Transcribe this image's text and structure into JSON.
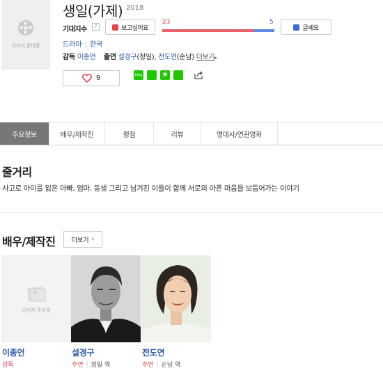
{
  "poster": {
    "placeholder": "이미지 준비중"
  },
  "movie": {
    "title": "생일(가제)",
    "year": "2018"
  },
  "expectation": {
    "label": "기대지수",
    "help": "?",
    "want_label": "보고싶어요",
    "not_want_label": "글쎄요",
    "want_count": "23",
    "not_want_count": "5",
    "want_fraction": 0.82
  },
  "genres": [
    "드라마",
    "한국"
  ],
  "credits": {
    "director_label": "감독",
    "director": "이종언",
    "cast_label": "출연",
    "cast1": "설경구",
    "cast1_role": "(정일),",
    "cast2": "전도연",
    "cast2_role": "(순남)",
    "more": "더보기"
  },
  "likes": {
    "count": "9"
  },
  "share": {
    "blog": "blog"
  },
  "tabs": [
    "주요정보",
    "배우/제작진",
    "평점",
    "리뷰",
    "명대사/연관영화"
  ],
  "synopsis": {
    "title": "줄거리",
    "text": "사고로 아이를 잃은 아빠, 엄마, 동생 그리고 남겨진 이들이 함께 서로의 아픈 마음을 보듬어가는 이야기"
  },
  "cast_section": {
    "title": "배우/제작진",
    "more_label": "더보기",
    "placeholder": "이미지 준비중",
    "people": [
      {
        "name": "이종언",
        "role": "감독",
        "character": ""
      },
      {
        "name": "설경구",
        "role": "주연",
        "character": "정일 역"
      },
      {
        "name": "전도연",
        "role": "주연",
        "character": "순남 역"
      }
    ]
  },
  "colors": {
    "want": "#e8424f",
    "not_want": "#3d6bd6",
    "link": "#2a5ba8",
    "active_tab": "#777777"
  }
}
